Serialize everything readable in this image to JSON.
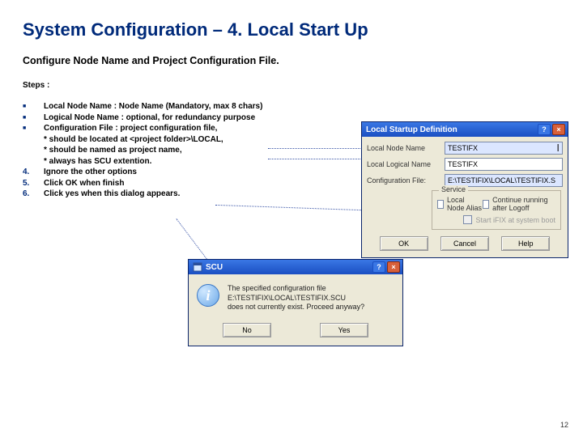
{
  "title": "System Configuration – 4. Local Start Up",
  "subtitle": "Configure Node Name and Project Configuration File.",
  "steps_label": "Steps :",
  "steps": [
    {
      "bullet": "sq",
      "text": "Local Node Name : Node Name (Mandatory, max 8 chars)"
    },
    {
      "bullet": "sq",
      "text": "Logical Node Name : optional, for redundancy purpose"
    },
    {
      "bullet": "sq",
      "text": "Configuration File : project configuration file,\n* should be located at <project folder>\\LOCAL,\n* should be named as project name,\n* always has SCU extention."
    },
    {
      "bullet": "4.",
      "text": "Ignore the other options"
    },
    {
      "bullet": "5.",
      "text": "Click OK when finish"
    },
    {
      "bullet": "6.",
      "text": "Click yes when this dialog appears."
    }
  ],
  "dlg1": {
    "title": "Local Startup Definition",
    "labels": {
      "local_node": "Local Node Name",
      "logical_node": "Local Logical Name",
      "config_file": "Configuration File:",
      "group": "Service",
      "chk_alias": "Local Node Alias",
      "chk_logoff": "Continue running after Logoff",
      "chk_boot": "Start iFIX at system boot"
    },
    "values": {
      "local_node": "TESTIFX",
      "logical_node": "TESTIFX",
      "config_file": "E:\\TESTIFIX\\LOCAL\\TESTIFIX.S"
    },
    "buttons": {
      "ok": "OK",
      "cancel": "Cancel",
      "help": "Help"
    }
  },
  "dlg2": {
    "title": "SCU",
    "message_l1": "The specified configuration file",
    "message_l2": "E:\\TESTIFIX\\LOCAL\\TESTIFIX.SCU",
    "message_l3": "does not currently exist. Proceed anyway?",
    "buttons": {
      "no": "No",
      "yes": "Yes"
    }
  },
  "pagenum": "12"
}
